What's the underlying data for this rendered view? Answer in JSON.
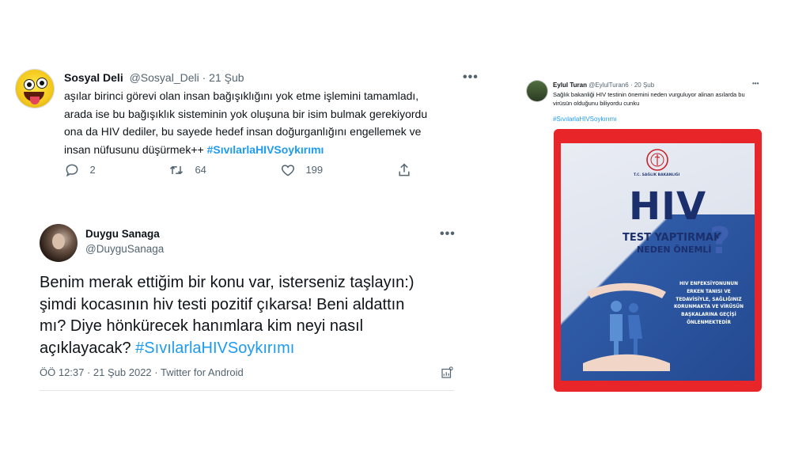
{
  "tweet1": {
    "display_name": "Sosyal Deli",
    "handle_time": "@Sosyal_Deli · 21 Şub",
    "more": "•••",
    "lines": [
      "aşılar birinci görevi olan insan bağışıklığını yok etme işlemini tamamladı,",
      "arada ise bu bağışıklık sisteminin yok oluşuna bir isim bulmak gerekiyordu",
      "ona da HIV  dediler, bu sayede hedef insan doğurganlığını engellemek ve",
      "insan nüfusunu düşürmek++ "
    ],
    "hashtag": "#SıvılarlaHIVSoykırımı",
    "replies": "2",
    "retweets": "64",
    "likes": "199"
  },
  "tweet2": {
    "display_name": "Duygu Sanaga",
    "handle": "@DuyguSanaga",
    "more": "•••",
    "lines": [
      "Benim merak ettiğim bir konu var, isterseniz taşlayın:)",
      "şimdi kocasının hiv testi pozitif çıkarsa! Beni aldattın",
      "mı? Diye hönkürecek hanımlara kim neyi nasıl",
      "açıklayacak? "
    ],
    "hashtag": "#SıvılarlaHIVSoykırımı",
    "meta": "ÖÖ 12:37 · 21 Şub 2022 · Twitter for Android"
  },
  "tweet3": {
    "display_name": "Eylul Turan",
    "handle_time": "@EylulTuran6 · 20 Şub",
    "more": "•••",
    "lines": [
      "Sağlık bakanliği HIV testinin önemini neden vurguluyor alinan asılarda bu",
      "virüsün olduğunu biliyordu cunku"
    ],
    "hashtag": "#SıvılarlaHIVSoykırımı",
    "poster": {
      "ministry": "T.C. SAĞLIK BAKANLIĞI",
      "title": "HIV",
      "subtitle1": "TEST YAPTIRMAK",
      "subtitle2": "NEDEN ÖNEMLİ",
      "qmark": "?",
      "body_lines": [
        "HIV ENFEKSİYONUNUN",
        "ERKEN TANISI VE",
        "TEDAVİSİYLE, SAĞLIĞINIZ",
        "KORUNMAKTA VE VİRÜSÜN",
        "BAŞKALARINA GEÇİŞİ",
        "ÖNLENMEKTEDİR"
      ]
    }
  },
  "colors": {
    "link": "#1d9bf0",
    "muted": "#536471",
    "frame_red": "#e8262a",
    "poster_blue": "#234a91"
  }
}
